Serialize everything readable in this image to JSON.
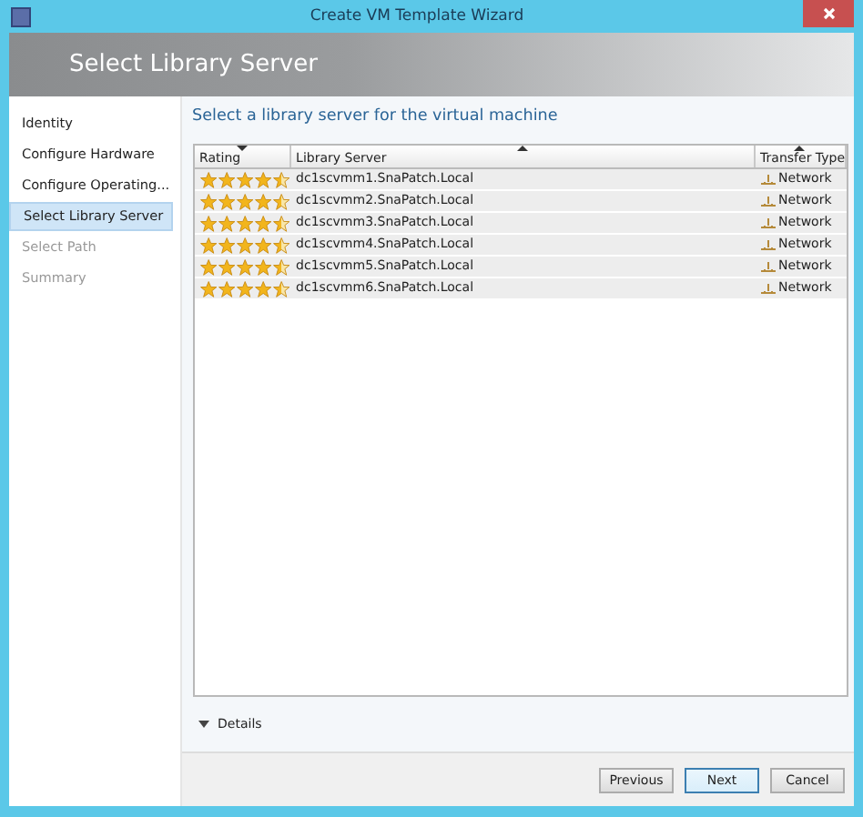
{
  "window": {
    "title": "Create VM Template Wizard"
  },
  "header": {
    "title": "Select Library Server"
  },
  "sidebar": {
    "items": [
      {
        "label": "Identity",
        "selected": false,
        "disabled": false
      },
      {
        "label": "Configure Hardware",
        "selected": false,
        "disabled": false
      },
      {
        "label": "Configure Operating...",
        "selected": false,
        "disabled": false
      },
      {
        "label": "Select Library Server",
        "selected": true,
        "disabled": false
      },
      {
        "label": "Select Path",
        "selected": false,
        "disabled": true
      },
      {
        "label": "Summary",
        "selected": false,
        "disabled": true
      }
    ]
  },
  "content": {
    "heading": "Select a library server for the virtual machine",
    "table": {
      "columns": [
        {
          "label": "Rating",
          "sort_descending": true
        },
        {
          "label": "Library Server",
          "sort_descending": false
        },
        {
          "label": "Transfer Type",
          "sort_descending": false
        }
      ],
      "rows": [
        {
          "stars": 4.5,
          "server": "dc1scvmm1.SnaPatch.Local",
          "transfer": "Network"
        },
        {
          "stars": 4.5,
          "server": "dc1scvmm2.SnaPatch.Local",
          "transfer": "Network"
        },
        {
          "stars": 4.5,
          "server": "dc1scvmm3.SnaPatch.Local",
          "transfer": "Network"
        },
        {
          "stars": 4.5,
          "server": "dc1scvmm4.SnaPatch.Local",
          "transfer": "Network"
        },
        {
          "stars": 4.5,
          "server": "dc1scvmm5.SnaPatch.Local",
          "transfer": "Network"
        },
        {
          "stars": 4.5,
          "server": "dc1scvmm6.SnaPatch.Local",
          "transfer": "Network"
        }
      ]
    },
    "details": {
      "label": "Details",
      "expanded": false
    }
  },
  "buttons": [
    {
      "label": "Previous",
      "default": false
    },
    {
      "label": "Next",
      "default": true
    },
    {
      "label": "Cancel",
      "default": false
    }
  ]
}
